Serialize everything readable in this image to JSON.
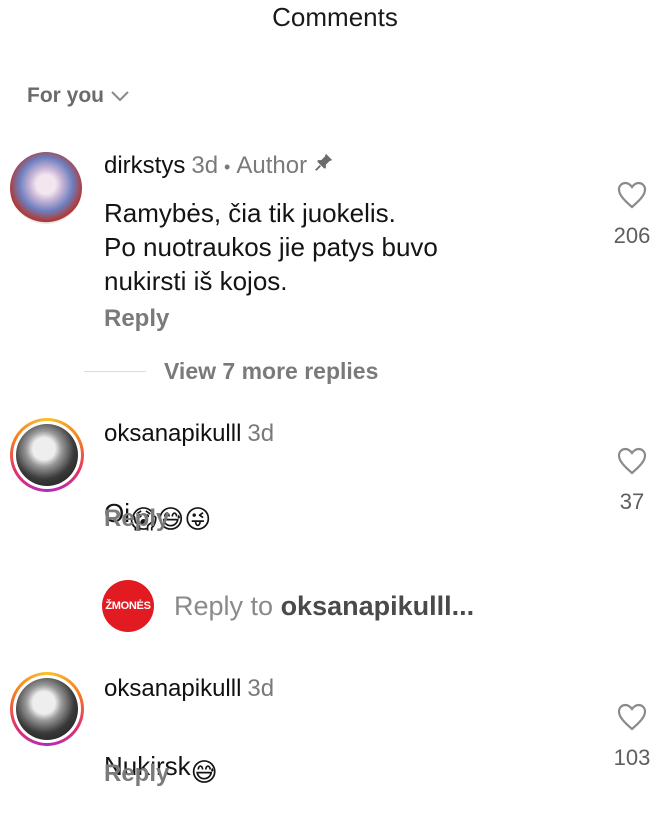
{
  "header": {
    "title": "Comments"
  },
  "filter": {
    "label": "For you",
    "icon": "chevron-down-icon"
  },
  "comments": [
    {
      "username": "dirkstys",
      "time": "3d",
      "separator": "•",
      "role": "Author",
      "pinned_icon": "pin-icon",
      "text": "Ramybės, čia tik juokelis.\nPo nuotraukos jie patys buvo\nnukirsti iš kojos.",
      "reply_label": "Reply",
      "likes": "206"
    },
    {
      "username": "oksanapikulll",
      "time": "3d",
      "text": "Oi",
      "emojis": [
        "😱",
        "😅",
        "😜"
      ],
      "reply_label": "Reply",
      "likes": "37"
    },
    {
      "username": "oksanapikulll",
      "time": "3d",
      "text": "Nukirsk",
      "emojis": [
        "😅"
      ],
      "reply_label": "Reply",
      "likes": "103"
    }
  ],
  "view_more": {
    "label": "View 7 more replies"
  },
  "reply_bar": {
    "brand_label": "ŽMONĖS",
    "prefix": "Reply to ",
    "target": "oksanapikulll..."
  },
  "colors": {
    "brand_red": "#e21a22",
    "muted": "#7a7a7a"
  }
}
